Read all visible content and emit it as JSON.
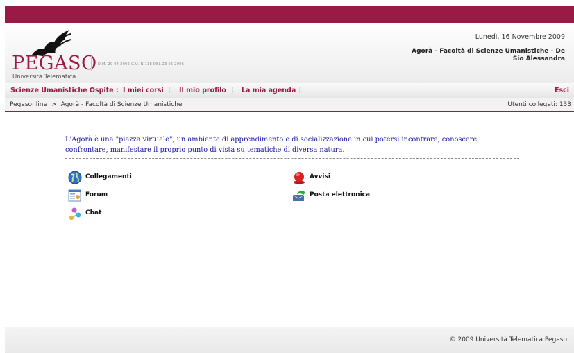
{
  "header": {
    "logo_word": "PEGASO",
    "logo_sub": "Università Telematica",
    "decree": "D.M. 20 04 2006 G.U. N.118 DEL 23 05 2006",
    "date": "Lunedì, 16 Novembre 2009",
    "faculty_title": "Agorà - Facoltà di Scienze Umanistiche - De Sio Alessandra"
  },
  "nav": {
    "section": "Scienze Umanistiche Ospite :",
    "items": [
      "I miei corsi",
      "Il mio profilo",
      "La mia agenda"
    ],
    "separator": "¦",
    "logout": "Esci"
  },
  "breadcrumb": {
    "items": [
      "Pegasonline",
      "Agorà - Facoltà di Scienze Umanistiche"
    ],
    "arrow": ">",
    "online_users": "Utenti collegati: 133"
  },
  "intro": "L'Agorà è una \"piazza virtuale\", un ambiente di apprendimento e di socializzazione in cui potersi incontrare, conoscere, confrontare, manifestare il proprio punto di vista su tematiche di diversa natura.",
  "tools": [
    {
      "label": "Collegamenti",
      "icon": "globe-icon"
    },
    {
      "label": "Forum",
      "icon": "forum-icon"
    },
    {
      "label": "Chat",
      "icon": "chat-icon"
    },
    {
      "label": "Avvisi",
      "icon": "alarm-icon"
    },
    {
      "label": "Posta elettronica",
      "icon": "mail-icon"
    }
  ],
  "footer": {
    "copyright": "© 2009 Università Telematica Pegaso"
  },
  "colors": {
    "brand": "#9a1a46",
    "intro_text": "#1a1aa0"
  }
}
